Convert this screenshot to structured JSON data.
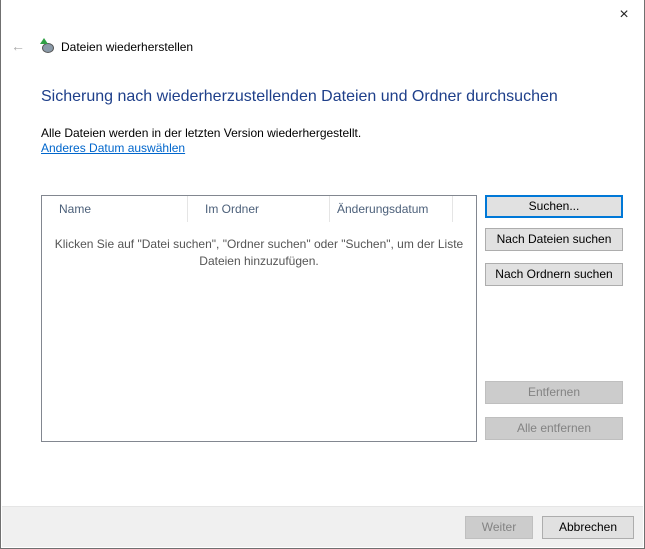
{
  "window": {
    "close_icon": "×",
    "back_icon": "←",
    "title": "Dateien wiederherstellen"
  },
  "heading": "Sicherung nach wiederherzustellenden Dateien und Ordner durchsuchen",
  "info": "Alle Dateien werden in der letzten Version wiederhergestellt.",
  "link": "Anderes Datum auswählen",
  "list": {
    "columns": [
      "Name",
      "Im Ordner",
      "Änderungsdatum"
    ],
    "empty_text": "Klicken Sie auf \"Datei suchen\", \"Ordner suchen\" oder \"Suchen\", um der Liste Dateien hinzuzufügen."
  },
  "buttons": {
    "search": "Suchen...",
    "files": "Nach Dateien suchen",
    "folders": "Nach Ordnern suchen",
    "remove": "Entfernen",
    "remove_all": "Alle entfernen",
    "next": "Weiter",
    "cancel": "Abbrechen"
  }
}
